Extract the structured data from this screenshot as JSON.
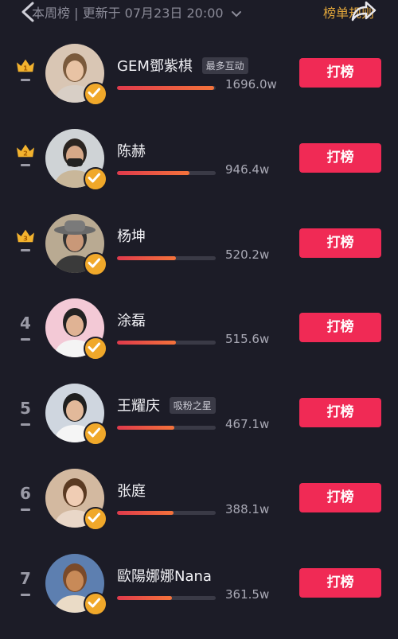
{
  "header": {
    "title": "本周榜",
    "separator": "|",
    "updated": "更新于 07月23日 20:00",
    "rules_link": "榜单规则"
  },
  "colors": {
    "accent": "#f02a55",
    "gold": "#e0a53a",
    "verify": "#f0a82a",
    "bg": "#1c1c27"
  },
  "list": [
    {
      "rank": "1",
      "crown": true,
      "name": "GEM鄧紫棋",
      "tag": "最多互动",
      "value": "1696.0w",
      "progress": 0.98,
      "button": "打榜",
      "avatar": "avatar-1"
    },
    {
      "rank": "2",
      "crown": true,
      "name": "陈赫",
      "tag": "",
      "value": "946.4w",
      "progress": 0.73,
      "button": "打榜",
      "avatar": "avatar-2"
    },
    {
      "rank": "3",
      "crown": true,
      "name": "杨坤",
      "tag": "",
      "value": "520.2w",
      "progress": 0.6,
      "button": "打榜",
      "avatar": "avatar-3"
    },
    {
      "rank": "4",
      "crown": false,
      "name": "涂磊",
      "tag": "",
      "value": "515.6w",
      "progress": 0.6,
      "button": "打榜",
      "avatar": "avatar-4"
    },
    {
      "rank": "5",
      "crown": false,
      "name": "王耀庆",
      "tag": "吸粉之星",
      "value": "467.1w",
      "progress": 0.58,
      "button": "打榜",
      "avatar": "avatar-5"
    },
    {
      "rank": "6",
      "crown": false,
      "name": "张庭",
      "tag": "",
      "value": "388.1w",
      "progress": 0.57,
      "button": "打榜",
      "avatar": "avatar-6"
    },
    {
      "rank": "7",
      "crown": false,
      "name": "歐陽娜娜Nana",
      "tag": "",
      "value": "361.5w",
      "progress": 0.56,
      "button": "打榜",
      "avatar": "avatar-7"
    }
  ]
}
